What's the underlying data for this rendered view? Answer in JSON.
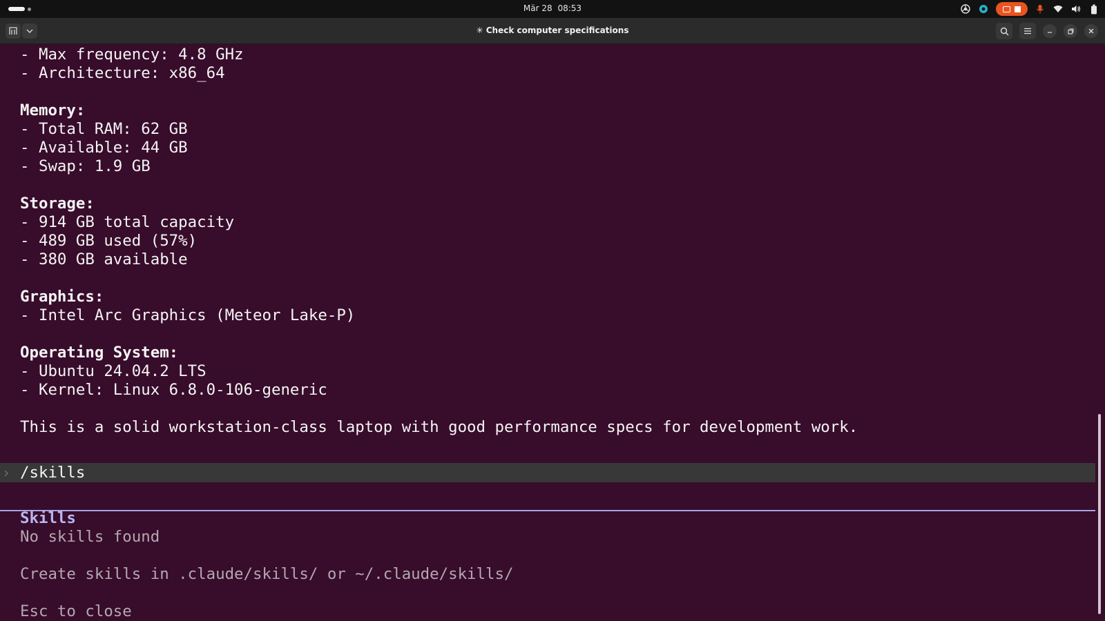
{
  "system_bar": {
    "date": "Mär 28",
    "time": "08:53"
  },
  "window": {
    "title": "✳ Check computer specifications"
  },
  "terminal": {
    "lines": [
      "- Max frequency: 4.8 GHz",
      "- Architecture: x86_64",
      "",
      "Memory:",
      "- Total RAM: 62 GB",
      "- Available: 44 GB",
      "- Swap: 1.9 GB",
      "",
      "Storage:",
      "- 914 GB total capacity",
      "- 489 GB used (57%)",
      "- 380 GB available",
      "",
      "Graphics:",
      "- Intel Arc Graphics (Meteor Lake-P)",
      "",
      "Operating System:",
      "- Ubuntu 24.04.2 LTS",
      "- Kernel: Linux 6.8.0-106-generic",
      "",
      "This is a solid workstation-class laptop with good performance specs for development work."
    ],
    "prompt_symbol": "›",
    "prompt_command": "/skills",
    "skills_panel": {
      "title": "Skills",
      "status": "No skills found",
      "hint": "Create skills in .claude/skills/ or ~/.claude/skills/",
      "footer_partial": "Esc to close"
    }
  }
}
